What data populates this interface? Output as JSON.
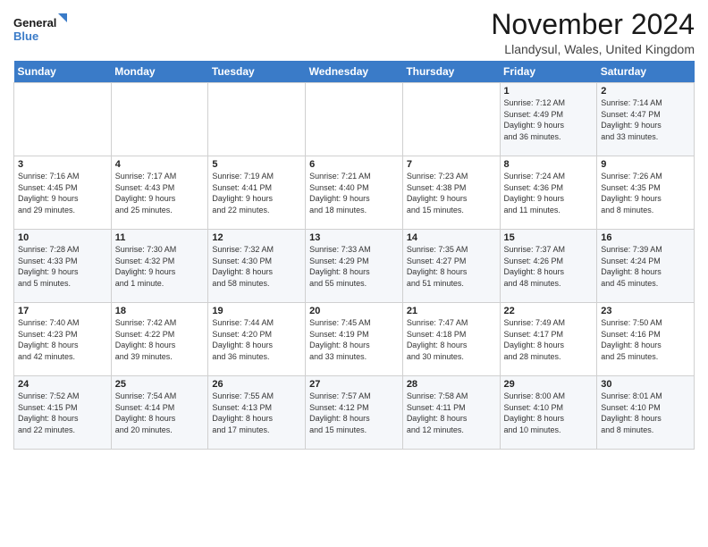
{
  "header": {
    "title": "November 2024",
    "location": "Llandysul, Wales, United Kingdom",
    "logo_line1": "General",
    "logo_line2": "Blue"
  },
  "weekdays": [
    "Sunday",
    "Monday",
    "Tuesday",
    "Wednesday",
    "Thursday",
    "Friday",
    "Saturday"
  ],
  "weeks": [
    [
      {
        "day": "",
        "info": ""
      },
      {
        "day": "",
        "info": ""
      },
      {
        "day": "",
        "info": ""
      },
      {
        "day": "",
        "info": ""
      },
      {
        "day": "",
        "info": ""
      },
      {
        "day": "1",
        "info": "Sunrise: 7:12 AM\nSunset: 4:49 PM\nDaylight: 9 hours\nand 36 minutes."
      },
      {
        "day": "2",
        "info": "Sunrise: 7:14 AM\nSunset: 4:47 PM\nDaylight: 9 hours\nand 33 minutes."
      }
    ],
    [
      {
        "day": "3",
        "info": "Sunrise: 7:16 AM\nSunset: 4:45 PM\nDaylight: 9 hours\nand 29 minutes."
      },
      {
        "day": "4",
        "info": "Sunrise: 7:17 AM\nSunset: 4:43 PM\nDaylight: 9 hours\nand 25 minutes."
      },
      {
        "day": "5",
        "info": "Sunrise: 7:19 AM\nSunset: 4:41 PM\nDaylight: 9 hours\nand 22 minutes."
      },
      {
        "day": "6",
        "info": "Sunrise: 7:21 AM\nSunset: 4:40 PM\nDaylight: 9 hours\nand 18 minutes."
      },
      {
        "day": "7",
        "info": "Sunrise: 7:23 AM\nSunset: 4:38 PM\nDaylight: 9 hours\nand 15 minutes."
      },
      {
        "day": "8",
        "info": "Sunrise: 7:24 AM\nSunset: 4:36 PM\nDaylight: 9 hours\nand 11 minutes."
      },
      {
        "day": "9",
        "info": "Sunrise: 7:26 AM\nSunset: 4:35 PM\nDaylight: 9 hours\nand 8 minutes."
      }
    ],
    [
      {
        "day": "10",
        "info": "Sunrise: 7:28 AM\nSunset: 4:33 PM\nDaylight: 9 hours\nand 5 minutes."
      },
      {
        "day": "11",
        "info": "Sunrise: 7:30 AM\nSunset: 4:32 PM\nDaylight: 9 hours\nand 1 minute."
      },
      {
        "day": "12",
        "info": "Sunrise: 7:32 AM\nSunset: 4:30 PM\nDaylight: 8 hours\nand 58 minutes."
      },
      {
        "day": "13",
        "info": "Sunrise: 7:33 AM\nSunset: 4:29 PM\nDaylight: 8 hours\nand 55 minutes."
      },
      {
        "day": "14",
        "info": "Sunrise: 7:35 AM\nSunset: 4:27 PM\nDaylight: 8 hours\nand 51 minutes."
      },
      {
        "day": "15",
        "info": "Sunrise: 7:37 AM\nSunset: 4:26 PM\nDaylight: 8 hours\nand 48 minutes."
      },
      {
        "day": "16",
        "info": "Sunrise: 7:39 AM\nSunset: 4:24 PM\nDaylight: 8 hours\nand 45 minutes."
      }
    ],
    [
      {
        "day": "17",
        "info": "Sunrise: 7:40 AM\nSunset: 4:23 PM\nDaylight: 8 hours\nand 42 minutes."
      },
      {
        "day": "18",
        "info": "Sunrise: 7:42 AM\nSunset: 4:22 PM\nDaylight: 8 hours\nand 39 minutes."
      },
      {
        "day": "19",
        "info": "Sunrise: 7:44 AM\nSunset: 4:20 PM\nDaylight: 8 hours\nand 36 minutes."
      },
      {
        "day": "20",
        "info": "Sunrise: 7:45 AM\nSunset: 4:19 PM\nDaylight: 8 hours\nand 33 minutes."
      },
      {
        "day": "21",
        "info": "Sunrise: 7:47 AM\nSunset: 4:18 PM\nDaylight: 8 hours\nand 30 minutes."
      },
      {
        "day": "22",
        "info": "Sunrise: 7:49 AM\nSunset: 4:17 PM\nDaylight: 8 hours\nand 28 minutes."
      },
      {
        "day": "23",
        "info": "Sunrise: 7:50 AM\nSunset: 4:16 PM\nDaylight: 8 hours\nand 25 minutes."
      }
    ],
    [
      {
        "day": "24",
        "info": "Sunrise: 7:52 AM\nSunset: 4:15 PM\nDaylight: 8 hours\nand 22 minutes."
      },
      {
        "day": "25",
        "info": "Sunrise: 7:54 AM\nSunset: 4:14 PM\nDaylight: 8 hours\nand 20 minutes."
      },
      {
        "day": "26",
        "info": "Sunrise: 7:55 AM\nSunset: 4:13 PM\nDaylight: 8 hours\nand 17 minutes."
      },
      {
        "day": "27",
        "info": "Sunrise: 7:57 AM\nSunset: 4:12 PM\nDaylight: 8 hours\nand 15 minutes."
      },
      {
        "day": "28",
        "info": "Sunrise: 7:58 AM\nSunset: 4:11 PM\nDaylight: 8 hours\nand 12 minutes."
      },
      {
        "day": "29",
        "info": "Sunrise: 8:00 AM\nSunset: 4:10 PM\nDaylight: 8 hours\nand 10 minutes."
      },
      {
        "day": "30",
        "info": "Sunrise: 8:01 AM\nSunset: 4:10 PM\nDaylight: 8 hours\nand 8 minutes."
      }
    ]
  ]
}
